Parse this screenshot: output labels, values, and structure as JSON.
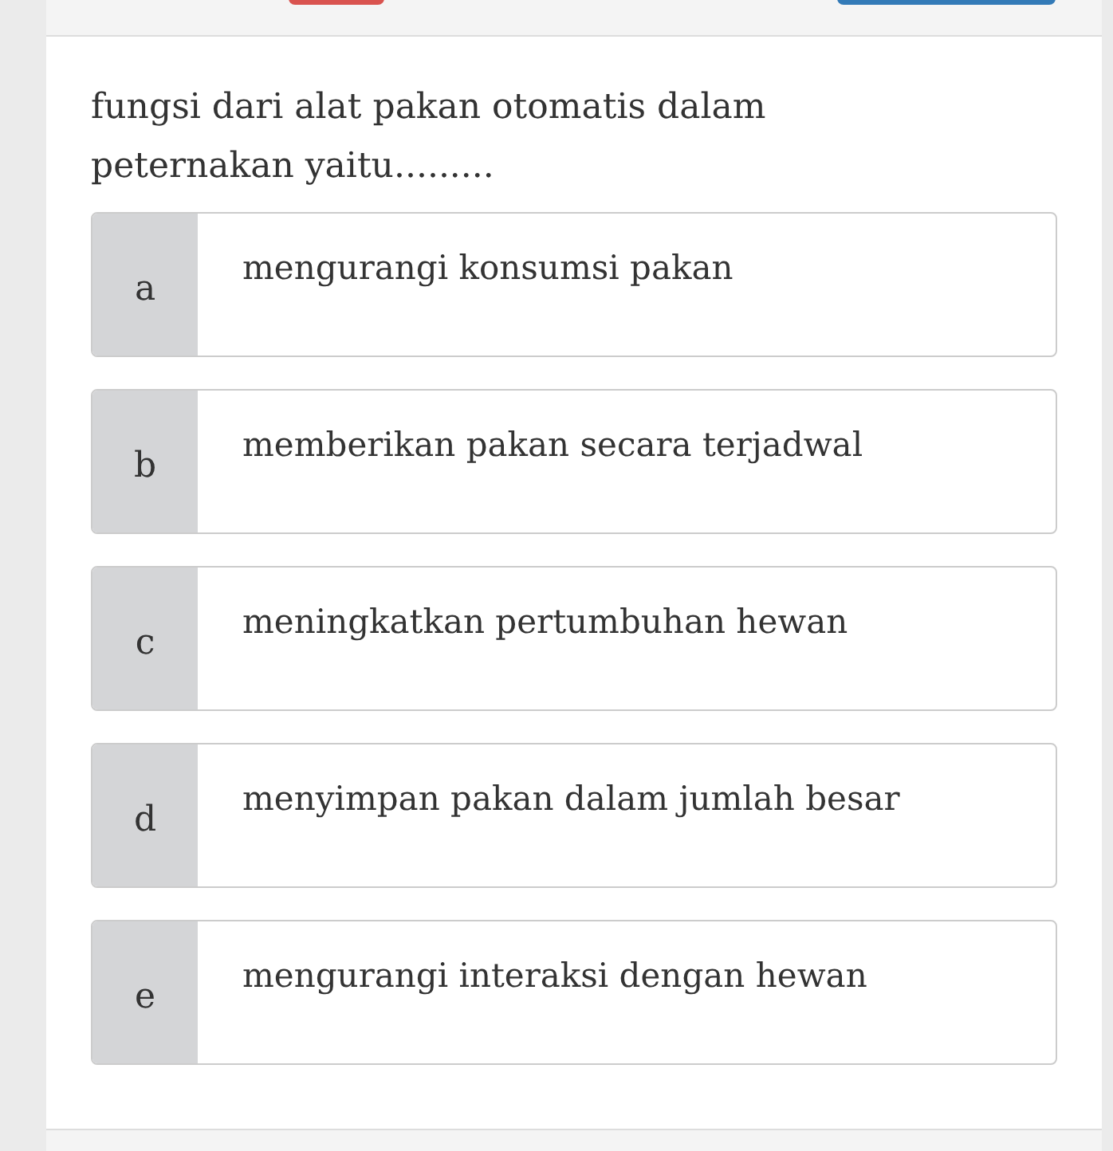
{
  "question": "fungsi dari alat pakan otomatis dalam peternakan yaitu.........",
  "options": [
    {
      "letter": "a",
      "text": "mengurangi konsumsi pakan"
    },
    {
      "letter": "b",
      "text": "memberikan pakan secara terjadwal"
    },
    {
      "letter": "c",
      "text": "meningkatkan pertumbuhan hewan"
    },
    {
      "letter": "d",
      "text": "menyimpan pakan dalam jumlah besar"
    },
    {
      "letter": "e",
      "text": "mengurangi interaksi dengan hewan"
    }
  ]
}
